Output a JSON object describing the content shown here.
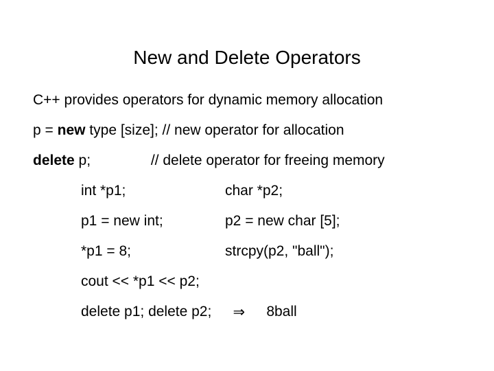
{
  "title": "New and Delete Operators",
  "intro": "C++ provides operators for dynamic memory allocation",
  "new_syntax_pre": "p = ",
  "new_kw": "new",
  "new_syntax_post": " type [size]; // new operator for allocation",
  "delete_kw": "delete",
  "delete_syntax_post": " p;",
  "delete_comment": "// delete operator for freeing memory",
  "code": {
    "r1l": "int *p1;",
    "r1r": "char *p2;",
    "r2l": "p1 = new int;",
    "r2r": "p2 = new char [5];",
    "r3l": "*p1 = 8;",
    "r3r": "strcpy(p2, \"ball\");",
    "r4": "cout << *p1 << p2;",
    "r5": "delete p1;   delete p2;",
    "arrow": "⇒",
    "output": "8ball"
  }
}
